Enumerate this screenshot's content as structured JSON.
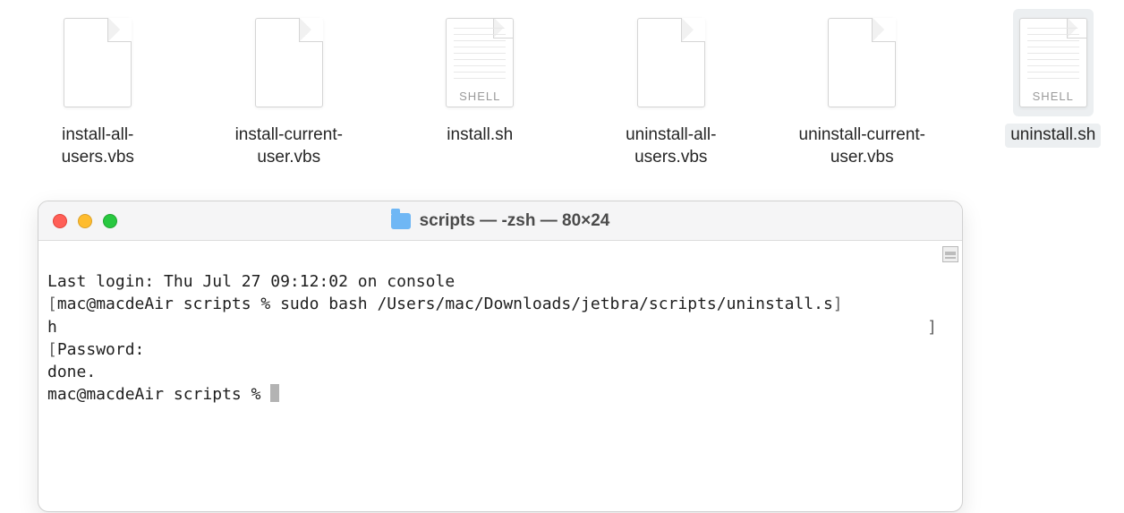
{
  "desktop": {
    "files": [
      {
        "name": "install-all-users.vbs",
        "icon": "blank",
        "selected": false
      },
      {
        "name": "install-current-user.vbs",
        "icon": "blank",
        "selected": false
      },
      {
        "name": "install.sh",
        "icon": "shell",
        "selected": false
      },
      {
        "name": "uninstall-all-users.vbs",
        "icon": "blank",
        "selected": false
      },
      {
        "name": "uninstall-current-user.vbs",
        "icon": "blank",
        "selected": false
      },
      {
        "name": "uninstall.sh",
        "icon": "shell",
        "selected": true
      }
    ],
    "shell_tag": "SHELL"
  },
  "terminal": {
    "title": "scripts — -zsh — 80×24",
    "lines": {
      "l0": "Last login: Thu Jul 27 09:12:02 on console",
      "l1": "mac@macdeAir scripts % sudo bash /Users/mac/Downloads/jetbra/scripts/uninstall.s",
      "l2": "h",
      "l3": "Password:",
      "l4": "done.",
      "l5": "mac@macdeAir scripts % "
    }
  }
}
